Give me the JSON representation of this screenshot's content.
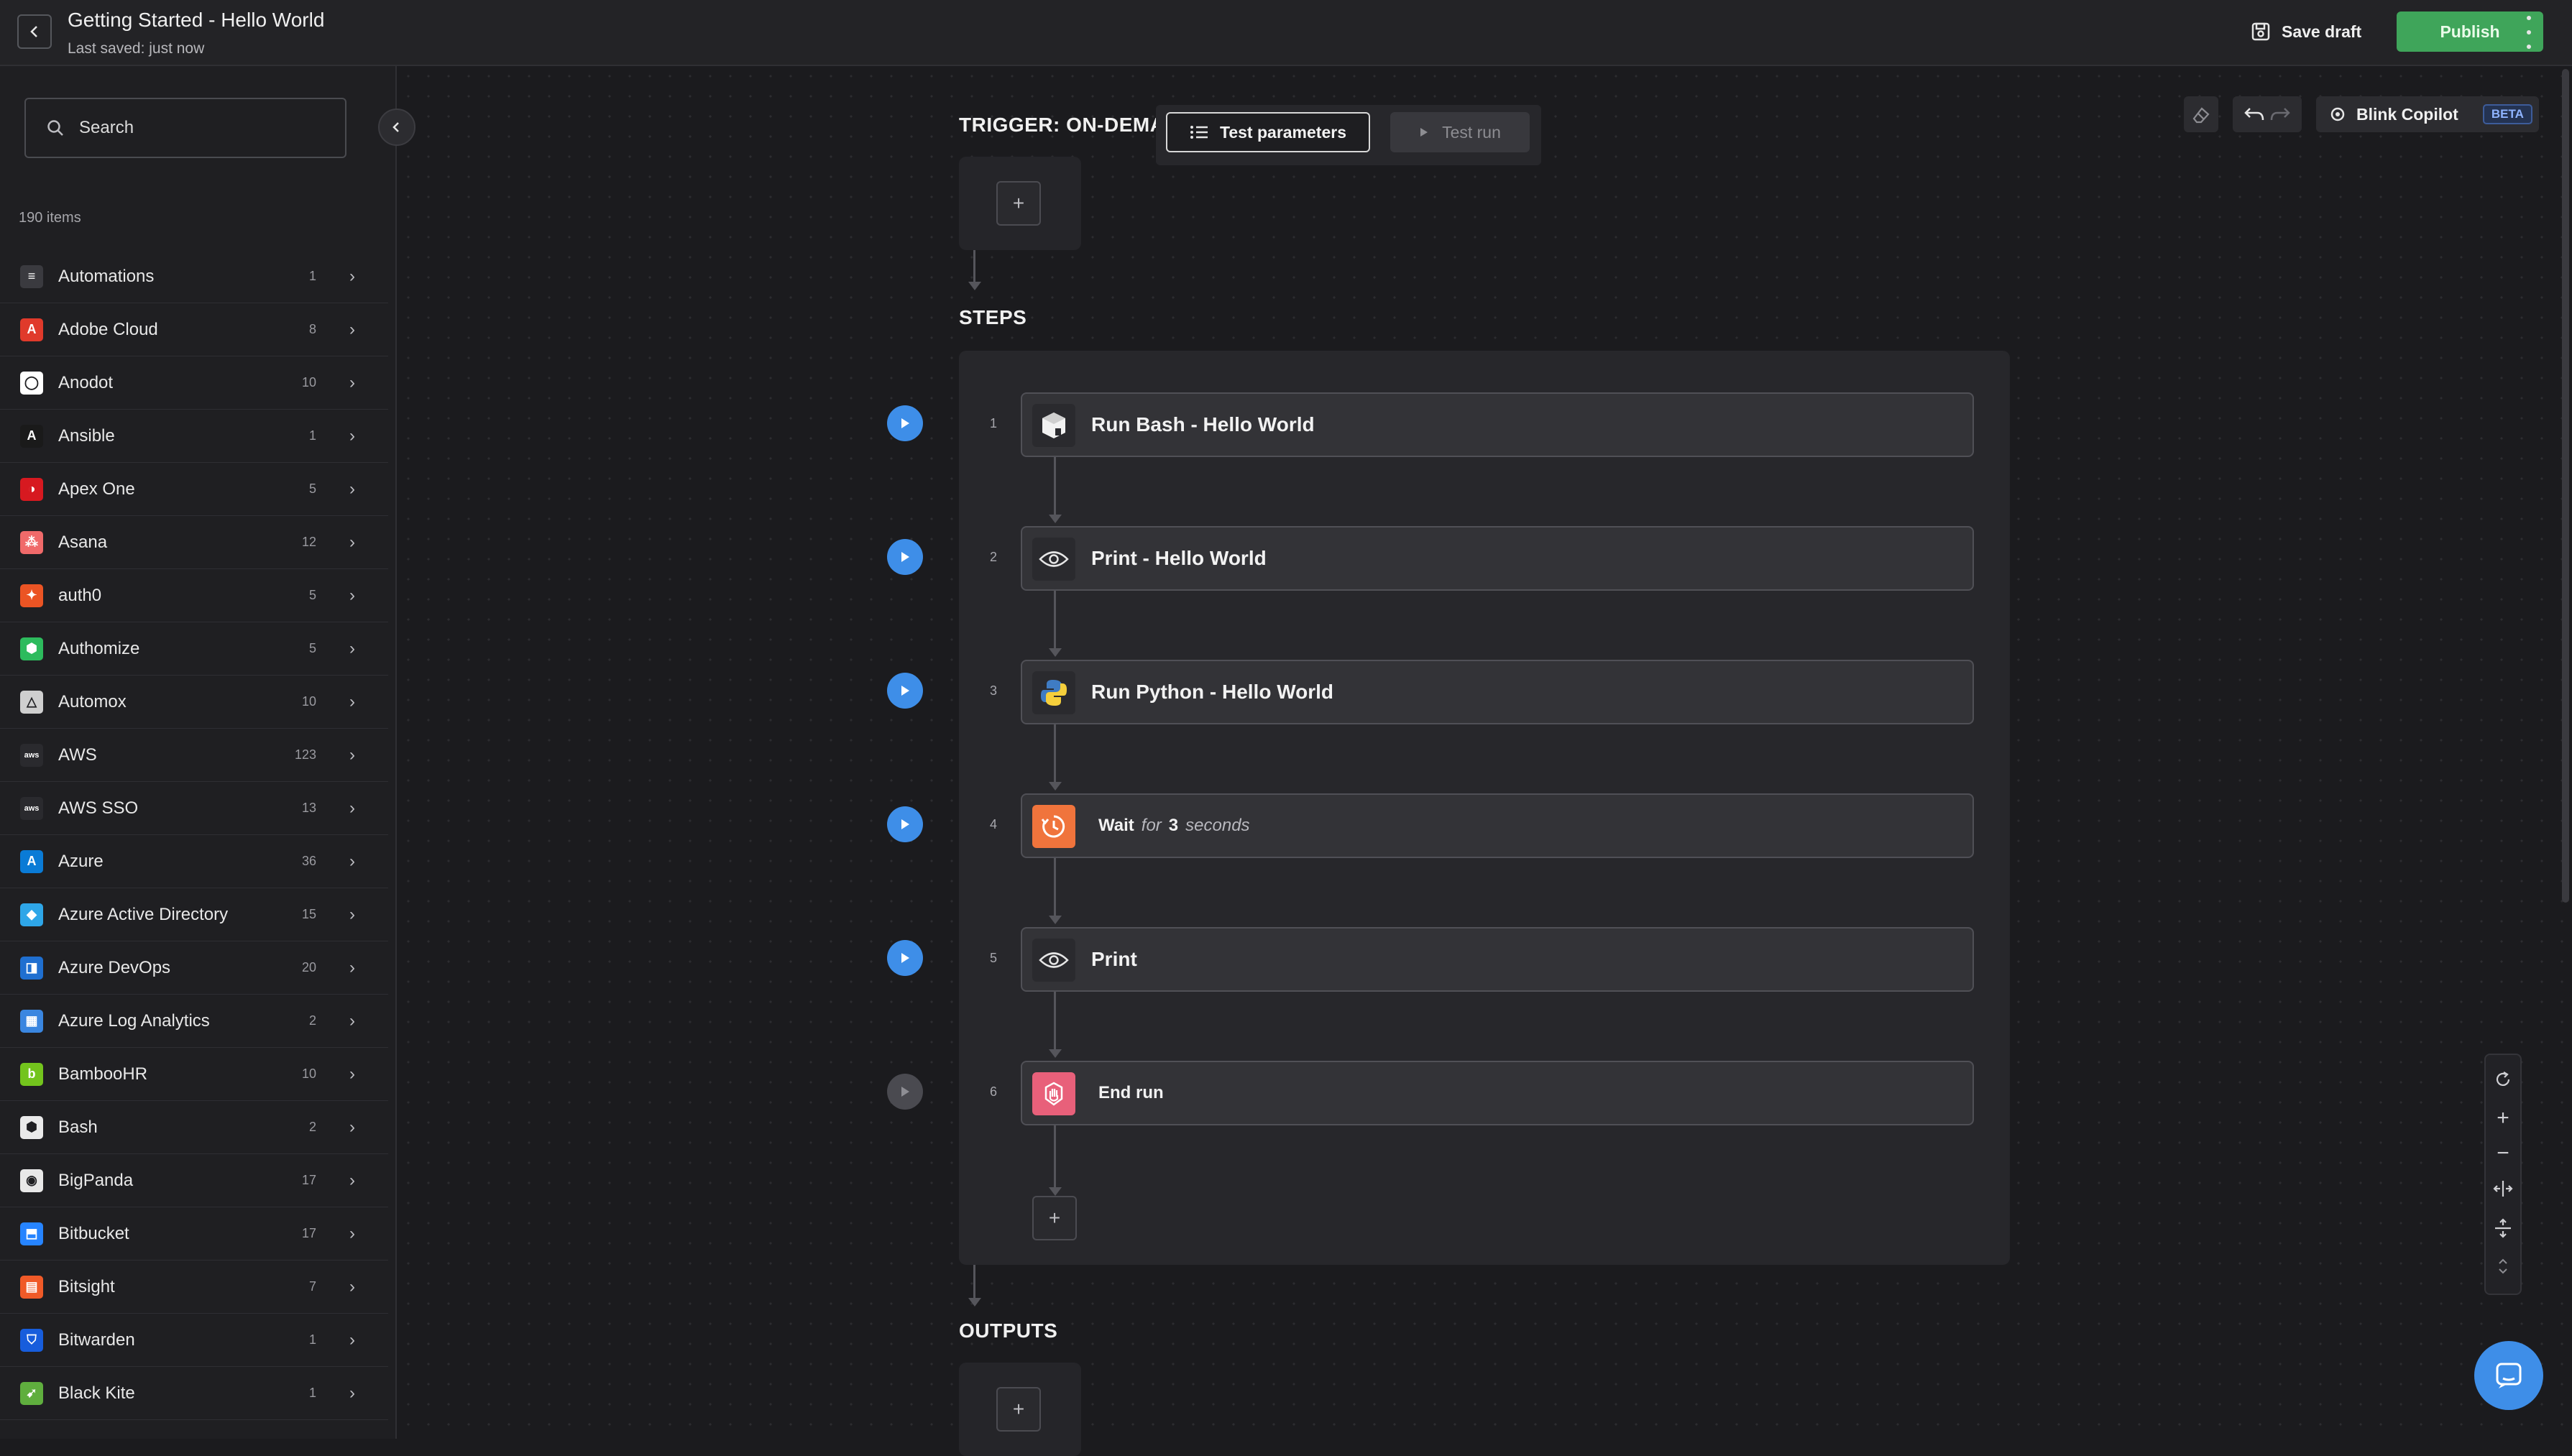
{
  "header": {
    "title": "Getting Started - Hello World",
    "subtitle": "Last saved: just now",
    "save_draft": "Save draft",
    "publish": "Publish"
  },
  "sidebar": {
    "search_placeholder": "Search",
    "item_count": "190 items",
    "items": [
      {
        "label": "Automations",
        "count": "1",
        "icon": "automations-icon",
        "color": "#3a3a3f"
      },
      {
        "label": "Adobe Cloud",
        "count": "8",
        "icon": "adobe-icon",
        "color": "#e03a2b"
      },
      {
        "label": "Anodot",
        "count": "10",
        "icon": "anodot-icon",
        "color": "#ffffff"
      },
      {
        "label": "Ansible",
        "count": "1",
        "icon": "ansible-icon",
        "color": "#1a1a1a"
      },
      {
        "label": "Apex One",
        "count": "5",
        "icon": "apex-one-icon",
        "color": "#d71920"
      },
      {
        "label": "Asana",
        "count": "12",
        "icon": "asana-icon",
        "color": "#f06a6a"
      },
      {
        "label": "auth0",
        "count": "5",
        "icon": "auth0-icon",
        "color": "#eb5424"
      },
      {
        "label": "Authomize",
        "count": "5",
        "icon": "authomize-icon",
        "color": "#2dbb5d"
      },
      {
        "label": "Automox",
        "count": "10",
        "icon": "automox-icon",
        "color": "#cfcfcf"
      },
      {
        "label": "AWS",
        "count": "123",
        "icon": "aws-icon",
        "color": "#2a2a2e"
      },
      {
        "label": "AWS SSO",
        "count": "13",
        "icon": "aws-sso-icon",
        "color": "#2a2a2e"
      },
      {
        "label": "Azure",
        "count": "36",
        "icon": "azure-icon",
        "color": "#0a7bd6"
      },
      {
        "label": "Azure Active Directory",
        "count": "15",
        "icon": "azure-ad-icon",
        "color": "#2ea6e8"
      },
      {
        "label": "Azure DevOps",
        "count": "20",
        "icon": "azure-devops-icon",
        "color": "#1f6fd0"
      },
      {
        "label": "Azure Log Analytics",
        "count": "2",
        "icon": "azure-log-analytics-icon",
        "color": "#3a86e0"
      },
      {
        "label": "BambooHR",
        "count": "10",
        "icon": "bamboohr-icon",
        "color": "#73c41d"
      },
      {
        "label": "Bash",
        "count": "2",
        "icon": "bash-icon",
        "color": "#eaeaea"
      },
      {
        "label": "BigPanda",
        "count": "17",
        "icon": "bigpanda-icon",
        "color": "#e8e8e8"
      },
      {
        "label": "Bitbucket",
        "count": "17",
        "icon": "bitbucket-icon",
        "color": "#2684ff"
      },
      {
        "label": "Bitsight",
        "count": "7",
        "icon": "bitsight-icon",
        "color": "#f05a28"
      },
      {
        "label": "Bitwarden",
        "count": "1",
        "icon": "bitwarden-icon",
        "color": "#175ddc"
      },
      {
        "label": "Black Kite",
        "count": "1",
        "icon": "black-kite-icon",
        "color": "#5fae3e"
      }
    ]
  },
  "canvas": {
    "trigger_label": "TRIGGER: ON-DEMAN",
    "test_parameters": "Test parameters",
    "test_run": "Test run",
    "steps_label": "STEPS",
    "outputs_label": "OUTPUTS",
    "copilot": "Blink Copilot",
    "beta": "BETA",
    "steps": [
      {
        "num": "1",
        "title": "Run Bash - Hello World",
        "icon": "bash-step-icon"
      },
      {
        "num": "2",
        "title": "Print - Hello World",
        "icon": "eye-icon"
      },
      {
        "num": "3",
        "title": "Run Python - Hello World",
        "icon": "python-icon"
      },
      {
        "num": "4",
        "title": "Wait",
        "wait_for": "for",
        "wait_value": "3",
        "wait_unit": "seconds",
        "icon": "timer-icon"
      },
      {
        "num": "5",
        "title": "Print",
        "icon": "eye-icon"
      },
      {
        "num": "6",
        "title": "End run",
        "icon": "stop-hand-icon"
      }
    ]
  },
  "colors": {
    "accent_blue": "#3e8ee8",
    "publish_green": "#3fa55a",
    "wait_orange": "#f0743c",
    "end_pink": "#e8607a"
  }
}
